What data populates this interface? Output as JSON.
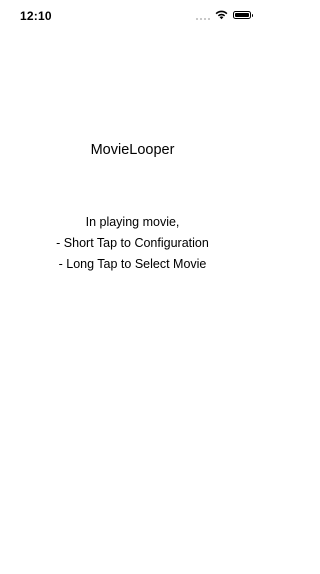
{
  "status_bar": {
    "time": "12:10",
    "icons": [
      "signal-dots-icon",
      "wifi-icon",
      "battery-icon"
    ]
  },
  "main": {
    "title": "MovieLooper",
    "instructions": [
      "In playing movie,",
      "- Short Tap to Configuration",
      "- Long Tap to Select Movie"
    ]
  }
}
